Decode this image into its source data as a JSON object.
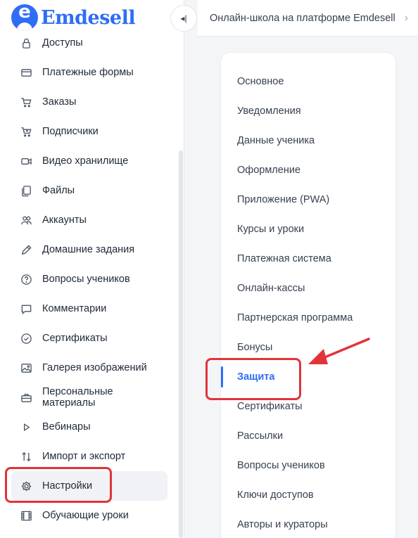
{
  "app": {
    "logo_text": "Emdesell",
    "logo_letter": "e"
  },
  "header": {
    "breadcrumb": "Онлайн-школа на платформе Emdesell",
    "collapse_glyph": "◂|"
  },
  "sidebar": {
    "items": [
      {
        "label": "Доступы",
        "icon": "lock-icon",
        "name": "access"
      },
      {
        "label": "Платежные формы",
        "icon": "credit-card-icon",
        "name": "payment-forms"
      },
      {
        "label": "Заказы",
        "icon": "cart-icon",
        "name": "orders"
      },
      {
        "label": "Подписчики",
        "icon": "cart-plus-icon",
        "name": "subscribers"
      },
      {
        "label": "Видео хранилище",
        "icon": "video-icon",
        "name": "video-storage"
      },
      {
        "label": "Файлы",
        "icon": "files-icon",
        "name": "files"
      },
      {
        "label": "Аккаунты",
        "icon": "users-icon",
        "name": "accounts"
      },
      {
        "label": "Домашние задания",
        "icon": "pencil-icon",
        "name": "homework"
      },
      {
        "label": "Вопросы учеников",
        "icon": "question-icon",
        "name": "student-questions"
      },
      {
        "label": "Комментарии",
        "icon": "comment-icon",
        "name": "comments"
      },
      {
        "label": "Сертификаты",
        "icon": "badge-check-icon",
        "name": "certificates"
      },
      {
        "label": "Галерея изображений",
        "icon": "image-icon",
        "name": "image-gallery"
      },
      {
        "label": "Персональные материалы",
        "icon": "briefcase-icon",
        "name": "personal-materials"
      },
      {
        "label": "Вебинары",
        "icon": "play-icon",
        "name": "webinars"
      },
      {
        "label": "Импорт и экспорт",
        "icon": "import-export-icon",
        "name": "import-export"
      },
      {
        "label": "Настройки",
        "icon": "gear-icon",
        "name": "settings",
        "active": true
      },
      {
        "label": "Обучающие уроки",
        "icon": "film-icon",
        "name": "tutorials"
      }
    ]
  },
  "settings_menu": {
    "items": [
      {
        "label": "Основное",
        "name": "general"
      },
      {
        "label": "Уведомления",
        "name": "notifications"
      },
      {
        "label": "Данные ученика",
        "name": "student-data"
      },
      {
        "label": "Оформление",
        "name": "appearance"
      },
      {
        "label": "Приложение (PWA)",
        "name": "pwa-app"
      },
      {
        "label": "Курсы и уроки",
        "name": "courses-lessons"
      },
      {
        "label": "Платежная система",
        "name": "payment-system"
      },
      {
        "label": "Онлайн-кассы",
        "name": "online-cash"
      },
      {
        "label": "Партнерская программа",
        "name": "affiliate-program"
      },
      {
        "label": "Бонусы",
        "name": "bonuses"
      },
      {
        "label": "Защита",
        "name": "protection",
        "active": true
      },
      {
        "label": "Сертификаты",
        "name": "certificates"
      },
      {
        "label": "Рассылки",
        "name": "mailings"
      },
      {
        "label": "Вопросы учеников",
        "name": "student-questions"
      },
      {
        "label": "Ключи доступов",
        "name": "access-keys"
      },
      {
        "label": "Авторы и кураторы",
        "name": "authors-curators"
      }
    ]
  },
  "colors": {
    "accent": "#2f6df6",
    "annotation": "#e0343a"
  }
}
